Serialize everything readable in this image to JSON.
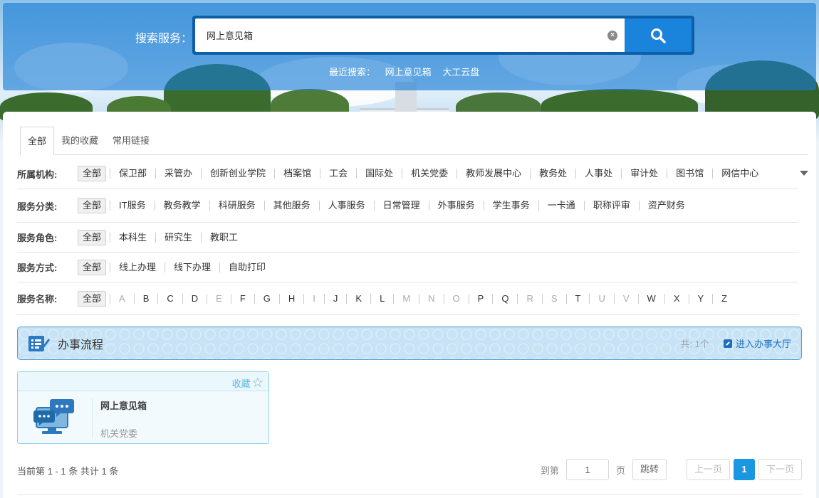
{
  "search": {
    "label": "搜索服务：",
    "value": "网上意见箱",
    "recent_label": "最近搜索：",
    "recent": [
      "网上意见箱",
      "大工云盘"
    ]
  },
  "tabs": [
    {
      "label": "全部",
      "active": true
    },
    {
      "label": "我的收藏",
      "active": false
    },
    {
      "label": "常用链接",
      "active": false
    }
  ],
  "filters": {
    "org": {
      "label": "所属机构:",
      "items": [
        "全部",
        "保卫部",
        "采管办",
        "创新创业学院",
        "档案馆",
        "工会",
        "国际处",
        "机关党委",
        "教师发展中心",
        "教务处",
        "人事处",
        "审计处",
        "图书馆",
        "网信中心"
      ]
    },
    "category": {
      "label": "服务分类:",
      "items": [
        "全部",
        "IT服务",
        "教务教学",
        "科研服务",
        "其他服务",
        "人事服务",
        "日常管理",
        "外事服务",
        "学生事务",
        "一卡通",
        "职称评审",
        "资产财务"
      ]
    },
    "role": {
      "label": "服务角色:",
      "items": [
        "全部",
        "本科生",
        "研究生",
        "教职工"
      ]
    },
    "method": {
      "label": "服务方式:",
      "items": [
        "全部",
        "线上办理",
        "线下办理",
        "自助打印"
      ]
    },
    "name": {
      "label": "服务名称:",
      "items": [
        "全部",
        "A",
        "B",
        "C",
        "D",
        "E",
        "F",
        "G",
        "H",
        "I",
        "J",
        "K",
        "L",
        "M",
        "N",
        "O",
        "P",
        "Q",
        "R",
        "S",
        "T",
        "U",
        "V",
        "W",
        "X",
        "Y",
        "Z"
      ],
      "disabled": [
        "A",
        "E",
        "I",
        "M",
        "N",
        "O",
        "R",
        "S",
        "U",
        "V"
      ]
    }
  },
  "section": {
    "title": "办事流程",
    "count": "共: 1个",
    "link": "进入办事大厅"
  },
  "card": {
    "fav_label": "收藏",
    "title": "网上意见箱",
    "dept": "机关党委"
  },
  "pagination": {
    "info": "当前第 1 - 1 条 共计 1 条",
    "goto_label": "到第",
    "page_value": "1",
    "page_unit": "页",
    "jump_label": "跳转",
    "prev_label": "上一页",
    "current": "1",
    "next_label": "下一页"
  },
  "colors": {
    "accent": "#1b96e0",
    "header": "#167ad4"
  }
}
